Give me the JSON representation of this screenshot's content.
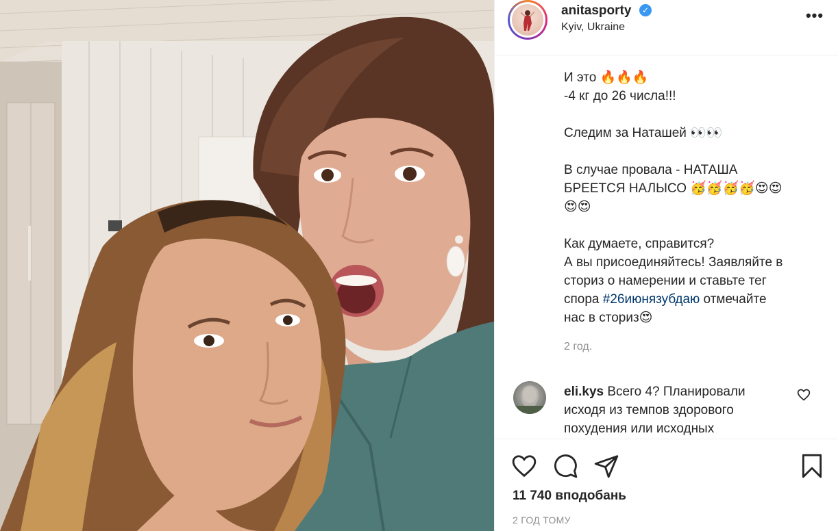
{
  "post": {
    "image_alt": "",
    "username": "anitasporty",
    "verified": true,
    "location": "Kyiv, Ukraine",
    "more_label": "•••"
  },
  "caption": {
    "line1": "И это 🔥🔥🔥",
    "line2": "-4 кг до 26 числа!!!",
    "line3": "Следим за Наташей 👀👀",
    "line4": "В случае провала - НАТАША",
    "line5": "БРЕЕТСЯ НАЛЫСО 🥳🥳🥳🥳😍😍",
    "line6": "😍😍",
    "line7": "Как думаете, справится?",
    "line8": "А вы присоединяйтесь! Заявляйте в",
    "line9": "сториз о намерении и ставьте тег",
    "line10_prefix": "спора ",
    "hashtag": "#26июнязубдаю",
    "line10_suffix": " отмечайте",
    "line11": "нас в сториз😍",
    "time_ago": "2 год."
  },
  "comment": {
    "username": "eli.kys",
    "text": " Всего 4? Планировали исходя из темпов здорового похудения или исходных"
  },
  "actions": {
    "likes": "11 740 вподобань",
    "posted": "2 ГОД ТОМУ"
  },
  "colors": {
    "accent": "#3897f0",
    "hashtag": "#00376b",
    "muted": "#8e8e8e"
  }
}
